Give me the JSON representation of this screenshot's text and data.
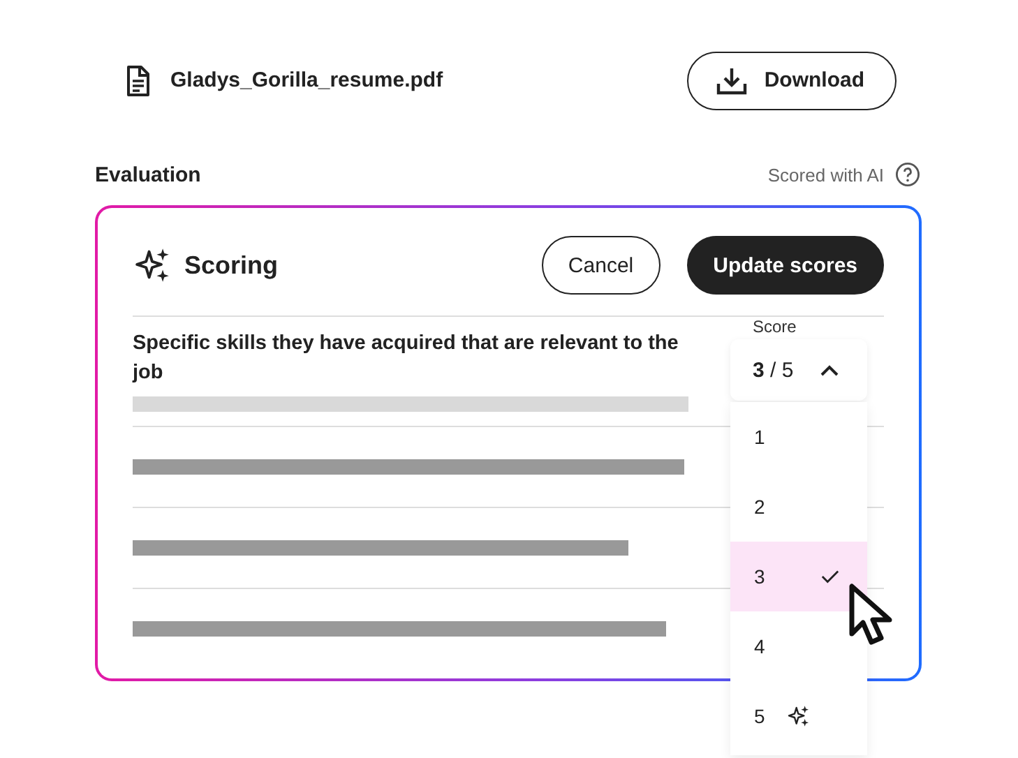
{
  "file": {
    "name": "Gladys_Gorilla_resume.pdf",
    "download_label": "Download"
  },
  "evaluation": {
    "title": "Evaluation",
    "ai_note": "Scored with AI"
  },
  "scoring": {
    "title": "Scoring",
    "buttons": [
      {
        "label": "Cancel",
        "kind": "secondary"
      },
      {
        "label": "Update scores",
        "kind": "primary"
      }
    ],
    "criterion": "Specific skills they have acquired that are relevant to the job",
    "score": {
      "label": "Score",
      "value": "**3** / 5",
      "expanded": true,
      "options": [
        {
          "label": "1",
          "selected": false,
          "ai_suggested": false
        },
        {
          "label": "2",
          "selected": false,
          "ai_suggested": false
        },
        {
          "label": "3",
          "selected": true,
          "ai_suggested": false
        },
        {
          "label": "4",
          "selected": false,
          "ai_suggested": false
        },
        {
          "label": "5",
          "selected": false,
          "ai_suggested": true
        }
      ]
    }
  }
}
